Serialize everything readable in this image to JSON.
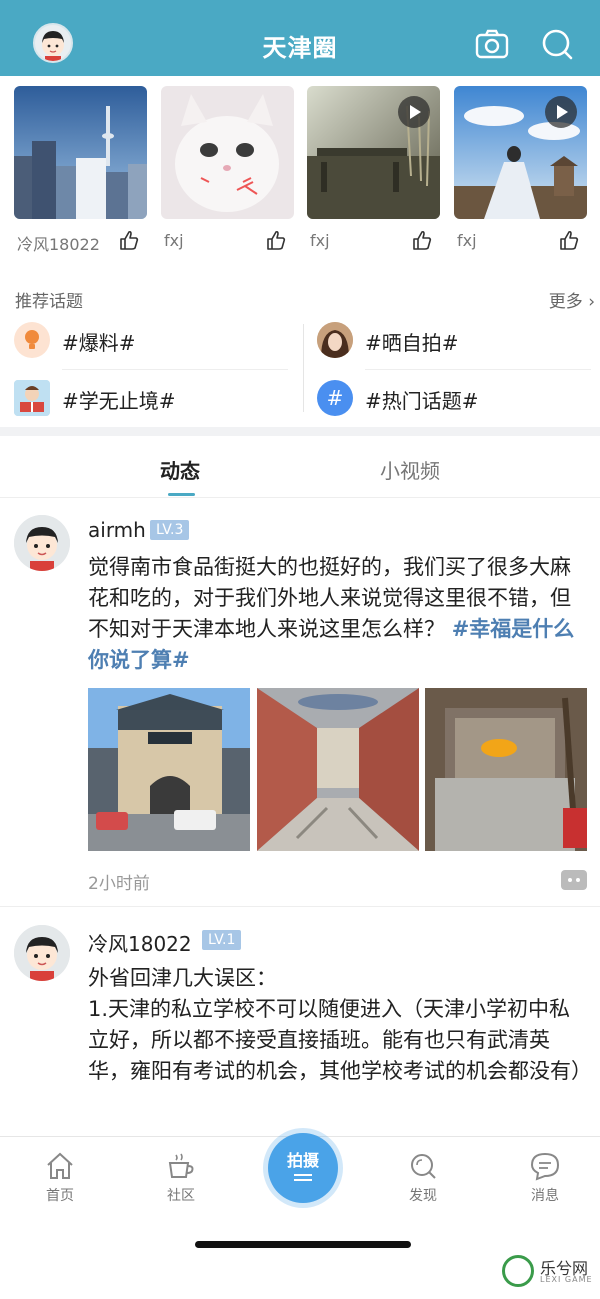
{
  "header": {
    "title": "天津圈"
  },
  "thumbnails": [
    {
      "author": "冷风18022",
      "has_play": false,
      "colors": [
        "#2f5f9c",
        "#8fb8de"
      ]
    },
    {
      "author": "fxj",
      "has_play": false,
      "colors": [
        "#e9e3e6",
        "#f4f0f1"
      ]
    },
    {
      "author": "fxj",
      "has_play": true,
      "colors": [
        "#5b5a47",
        "#a9a68c"
      ]
    },
    {
      "author": "fxj",
      "has_play": true,
      "colors": [
        "#4c8fd3",
        "#cfe0ee"
      ]
    }
  ],
  "topics": {
    "heading": "推荐话题",
    "more_label": "更多",
    "items": [
      {
        "label": "#爆料#"
      },
      {
        "label": "#晒自拍#"
      },
      {
        "label": "#学无止境#"
      },
      {
        "label": "#热门话题#"
      }
    ]
  },
  "tabs": [
    {
      "label": "动态",
      "active": true
    },
    {
      "label": "小视频",
      "active": false
    }
  ],
  "posts": [
    {
      "username": "airmh",
      "level": "LV.3",
      "text": "觉得南市食品街挺大的也挺好的，我们买了很多大麻花和吃的，对于我们外地人来说觉得这里很不错，但不知对于天津本地人来说这里怎么样？",
      "hashtag": "#幸福是什么你说了算#",
      "time": "2小时前"
    },
    {
      "username": "冷风18022",
      "level": "LV.1",
      "text_lines": [
        "外省回津几大误区：",
        "1.天津的私立学校不可以随便进入（天津小学初中私立好，所以都不接受直接插班。能有也只有武清英华，雍阳有考试的机会，其他学校考试的机会都没有）"
      ]
    }
  ],
  "bottom_nav": {
    "items": [
      {
        "label": "首页"
      },
      {
        "label": "社区"
      },
      {
        "label": "拍摄"
      },
      {
        "label": "发现"
      },
      {
        "label": "消息"
      }
    ]
  },
  "watermark": {
    "title": "乐兮网",
    "subtitle": "LEXI GAME"
  },
  "colors": {
    "header": "#4aa9c4",
    "accent": "#4aa3e8",
    "hashtag": "#4e7fb2",
    "level_badge": "#a7c6e6"
  }
}
